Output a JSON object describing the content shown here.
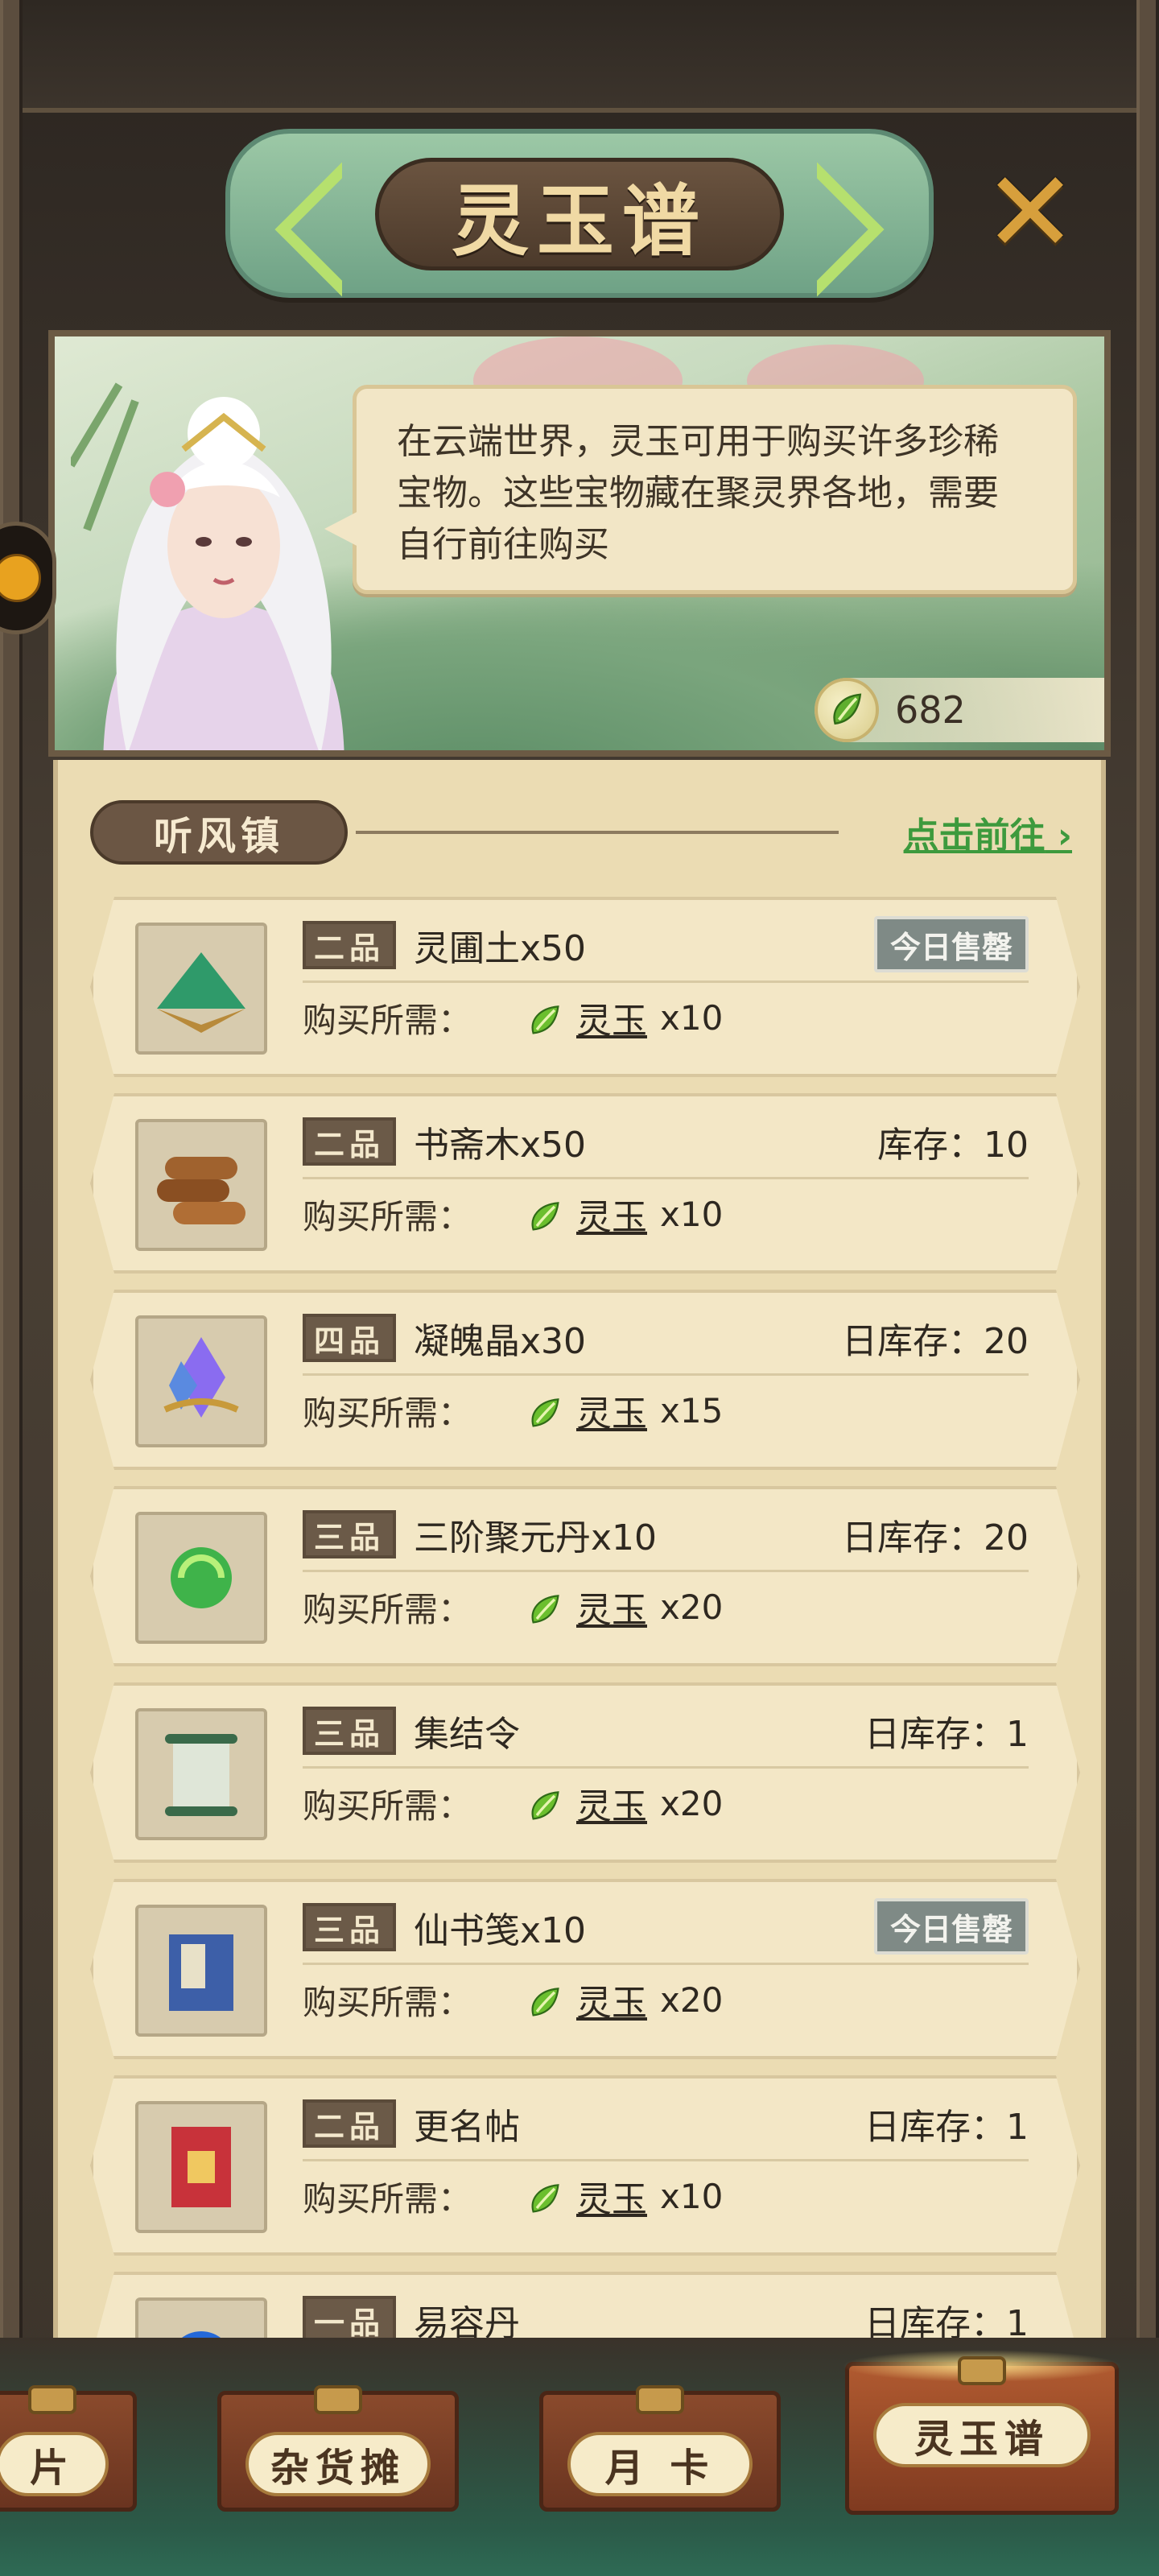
{
  "header": {
    "title": "灵玉谱"
  },
  "banner": {
    "description": "在云端世界，灵玉可用于购买许多珍稀宝物。这些宝物藏在聚灵界各地，需要自行前往购买",
    "currency_amount": "682"
  },
  "section": {
    "name": "听风镇",
    "goto_label": "点击前往"
  },
  "items": [
    {
      "grade": "二品",
      "name": "灵圃土x50",
      "status": "今日售罄",
      "sold_out": true,
      "price_label": "购买所需：",
      "currency": "灵玉",
      "price": "x10",
      "icon": "green-soil-icon"
    },
    {
      "grade": "二品",
      "name": "书斋木x50",
      "status": "库存：10",
      "sold_out": false,
      "price_label": "购买所需：",
      "currency": "灵玉",
      "price": "x10",
      "icon": "wood-logs-icon"
    },
    {
      "grade": "四品",
      "name": "凝魄晶x30",
      "status": "日库存：20",
      "sold_out": false,
      "price_label": "购买所需：",
      "currency": "灵玉",
      "price": "x15",
      "icon": "crystal-icon"
    },
    {
      "grade": "三品",
      "name": "三阶聚元丹x10",
      "status": "日库存：20",
      "sold_out": false,
      "price_label": "购买所需：",
      "currency": "灵玉",
      "price": "x20",
      "icon": "green-pill-icon"
    },
    {
      "grade": "三品",
      "name": "集结令",
      "status": "日库存：1",
      "sold_out": false,
      "price_label": "购买所需：",
      "currency": "灵玉",
      "price": "x20",
      "icon": "scroll-icon"
    },
    {
      "grade": "三品",
      "name": "仙书笺x10",
      "status": "今日售罄",
      "sold_out": true,
      "price_label": "购买所需：",
      "currency": "灵玉",
      "price": "x20",
      "icon": "book-icon"
    },
    {
      "grade": "二品",
      "name": "更名帖",
      "status": "日库存：1",
      "sold_out": false,
      "price_label": "购买所需：",
      "currency": "灵玉",
      "price": "x10",
      "icon": "red-card-icon"
    },
    {
      "grade": "一品",
      "name": "易容丹",
      "status": "日库存：1",
      "sold_out": false,
      "price_label": "",
      "currency": "",
      "price": "",
      "icon": "blue-orb-icon"
    }
  ],
  "bottom_nav": [
    {
      "label": "片",
      "active": false
    },
    {
      "label": "杂货摊",
      "active": false
    },
    {
      "label": "月 卡",
      "active": false
    },
    {
      "label": "灵玉谱",
      "active": true
    }
  ],
  "colors": {
    "link": "#3d9a3d",
    "panel": "#ebdcb3",
    "accent": "#d79f3c"
  }
}
